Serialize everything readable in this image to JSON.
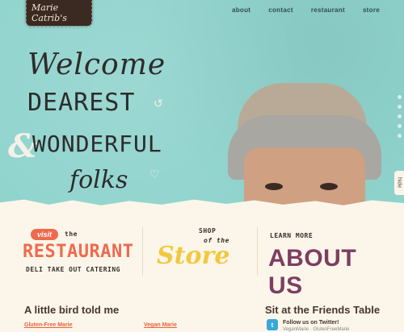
{
  "logo": {
    "text": "Marie Catrib's"
  },
  "nav": {
    "items": [
      "about",
      "contact",
      "restaurant",
      "store"
    ]
  },
  "hero": {
    "line1": "Welcome",
    "line2": "DEAREST",
    "amp": "&",
    "line3": "WONDERFUL",
    "line4": "folks",
    "hide_label": "hide"
  },
  "cta": {
    "restaurant": {
      "visit": "visit",
      "the": "the",
      "title": "RESTAURANT",
      "sub": "DELI  TAKE OUT  CATERING"
    },
    "store": {
      "shop": "SHOP",
      "ofthe": "of the",
      "title": "Store"
    },
    "about": {
      "learn": "LEARN MORE",
      "title": "ABOUT US"
    }
  },
  "footer": {
    "bird_title": "A little bird told me",
    "friends_title": "Sit at the Friends Table",
    "link1": "Gluten-Free Marie",
    "link2": "Vegan Marie",
    "follow": "Follow us on Twitter!",
    "follow_sub": "VeganMarie · GlutenFreeMarie"
  },
  "colors": {
    "hero_bg": "#8fd3cd",
    "orange": "#ef6a4e",
    "yellow": "#f2c83e",
    "purple": "#7e3d63"
  }
}
